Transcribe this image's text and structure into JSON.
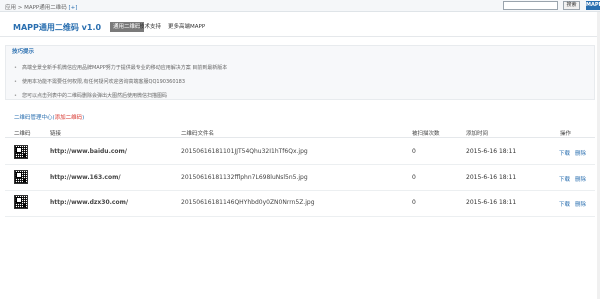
{
  "topbar": {
    "breadcrumb": "应用 > MAPP通用二维码",
    "plus": "[+]",
    "search_placeholder": "",
    "search_button": "搜索",
    "badge": "MAPP"
  },
  "header": {
    "title": "MAPP通用二维码 v1.0",
    "tabs": [
      {
        "label": "通用二维码",
        "active": true
      },
      {
        "label": "技术支持",
        "active": false
      },
      {
        "label": "更多高端MAPP",
        "active": false
      }
    ]
  },
  "help": {
    "title": "技巧提示",
    "tips": [
      "高端全景全新手机微信应用品牌MAPP努力于提供最专业的移动应用解决方案 目前到最新版本",
      "使用本功能不需要任何权限,有任何疑问欢迎咨询高端客服QQ190360183",
      "您可以点击列表中的二维码删除会弹出大图然后使用微信扫描图码"
    ]
  },
  "list": {
    "title_prefix": "二维码管理中心(",
    "title_add": "添加二维码",
    "title_suffix": ")",
    "columns": [
      "二维码",
      "链接",
      "二维码文件名",
      "被扫描次数",
      "添加时间",
      "操作"
    ],
    "rows": [
      {
        "url": "http://www.baidu.com/",
        "file": "20150616181101JJT54Qhu32I1hTf6Qx.jpg",
        "count": "0",
        "time": "2015-6-16 18:11",
        "edit": "下载",
        "del": "删除"
      },
      {
        "url": "http://www.163.com/",
        "file": "20150616181132fflphn7L698luNsl5n5.jpg",
        "count": "0",
        "time": "2015-6-16 18:11",
        "edit": "下载",
        "del": "删除"
      },
      {
        "url": "http://www.dzx30.com/",
        "file": "20150616181146QHYhbd0y0ZN0Nrrn5Z.jpg",
        "count": "0",
        "time": "2015-6-16 18:11",
        "edit": "下载",
        "del": "删除"
      }
    ]
  },
  "colors": {
    "accent": "#2a6fb0",
    "active_tab": "#7a7a7a",
    "add_link": "#d6322b"
  }
}
